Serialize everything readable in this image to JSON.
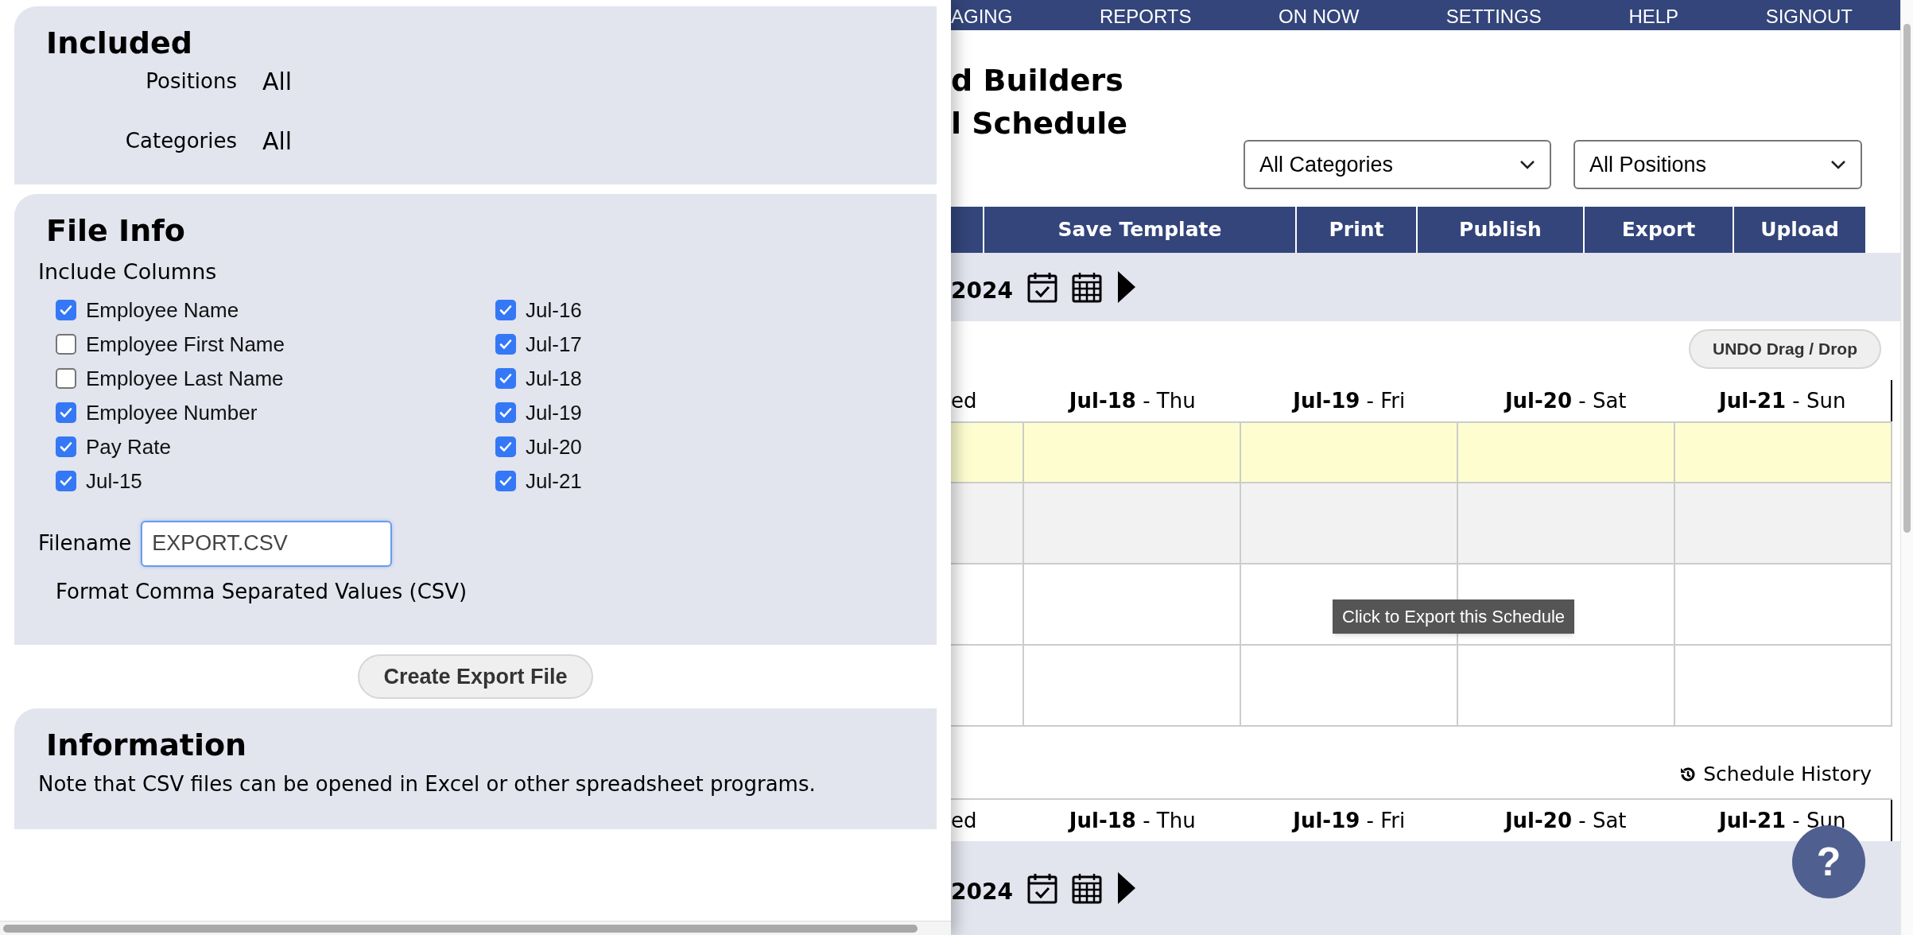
{
  "panel": {
    "included": {
      "title": "Included",
      "rows": [
        {
          "label": "Positions",
          "value": "All"
        },
        {
          "label": "Categories",
          "value": "All"
        }
      ]
    },
    "file_info": {
      "title": "File Info",
      "columns_label": "Include Columns",
      "columns_left": [
        {
          "label": "Employee Name",
          "checked": true
        },
        {
          "label": "Employee First Name",
          "checked": false
        },
        {
          "label": "Employee Last Name",
          "checked": false
        },
        {
          "label": "Employee Number",
          "checked": true
        },
        {
          "label": "Pay Rate",
          "checked": true
        },
        {
          "label": "Jul-15",
          "checked": true
        }
      ],
      "columns_right": [
        {
          "label": "Jul-16",
          "checked": true
        },
        {
          "label": "Jul-17",
          "checked": true
        },
        {
          "label": "Jul-18",
          "checked": true
        },
        {
          "label": "Jul-19",
          "checked": true
        },
        {
          "label": "Jul-20",
          "checked": true
        },
        {
          "label": "Jul-21",
          "checked": true
        }
      ],
      "filename_label": "Filename",
      "filename": "EXPORT.CSV",
      "format": "Format Comma Separated Values (CSV)"
    },
    "create_button": "Create Export File",
    "information": {
      "title": "Information",
      "text": "Note that CSV files can be opened in Excel or other spreadsheet programs."
    }
  },
  "page": {
    "nav": [
      "AGING",
      "REPORTS",
      "ON NOW",
      "SETTINGS",
      "HELP",
      "SIGNOUT"
    ],
    "title_lines": [
      "d Builders",
      "l Schedule"
    ],
    "filters": [
      "All Categories",
      "All Positions"
    ],
    "toolbar": [
      "Save Template",
      "Print",
      "Publish",
      "Export",
      "Upload"
    ],
    "week_label": "2024",
    "undo_button": "UNDO Drag / Drop",
    "first_column": "ed",
    "days": [
      {
        "date": "Jul-18",
        "day": "- Thu"
      },
      {
        "date": "Jul-19",
        "day": "- Fri"
      },
      {
        "date": "Jul-20",
        "day": "- Sat"
      },
      {
        "date": "Jul-21",
        "day": "- Sun"
      }
    ],
    "rows": [
      {
        "kind": "highlight"
      },
      {
        "kind": "shaded"
      },
      {
        "kind": "plain"
      },
      {
        "kind": "plain"
      }
    ],
    "tooltip": "Click to Export this Schedule",
    "history_link": "Schedule History",
    "second_header": {
      "first_column": "ed",
      "days": [
        {
          "date": "Jul-18",
          "day": "- Thu"
        },
        {
          "date": "Jul-19",
          "day": "- Fri"
        },
        {
          "date": "Jul-20",
          "day": "- Sat"
        },
        {
          "date": "Jul-21",
          "day": "- Sun"
        }
      ]
    },
    "second_week_label": "2024",
    "help_button": "?"
  }
}
